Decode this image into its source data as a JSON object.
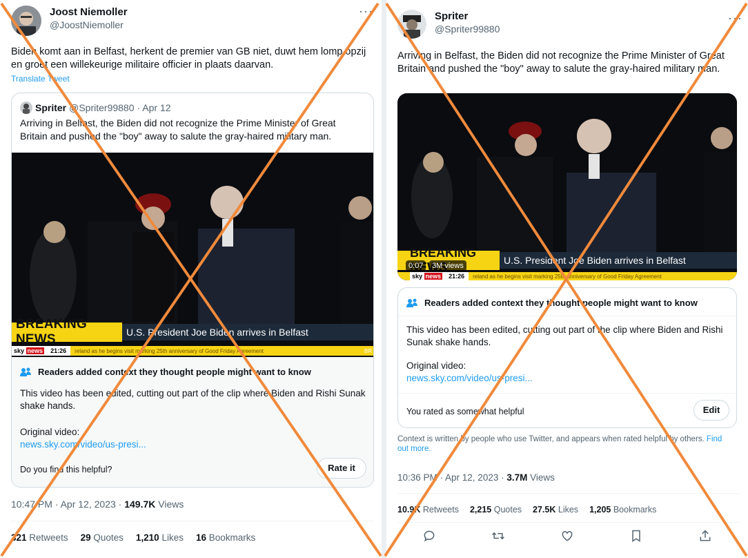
{
  "left_tweet": {
    "author_name": "Joost Niemoller",
    "author_handle": "@JoostNiemoller",
    "more_label": "···",
    "text": "Biden komt aan in Belfast, herkent de premier van GB niet, duwt hem lomp opzij en groet een willekeurige militaire officier in plaats daarvan.",
    "translate_label": "Translate Tweet",
    "quote": {
      "author_name": "Spriter",
      "author_handle": "@Spriter99880",
      "date": "· Apr 12",
      "text": "Arriving in Belfast, the Biden did not recognize the Prime Minister of Great Britain and pushed the \"boy\" away to salute the gray-haired military man.",
      "video": {
        "breaking": "BREAKING NEWS",
        "headline": "U.S. President Joe Biden arrives in Belfast",
        "sky": "sky",
        "sky_news": "news",
        "clock": "21:26",
        "ticker": "reland as he begins visit marking 25th anniversary of Good Friday Agreement",
        "ticker_end": "BR"
      },
      "notes": {
        "header": "Readers added context they thought people might want to know",
        "body": "This video has been edited, cutting out part of the clip where Biden and Rishi Sunak shake hands.",
        "original_label": "Original video:",
        "link": "news.sky.com/video/us-presi...",
        "question": "Do you find this helpful?",
        "rate_button": "Rate it"
      }
    },
    "timestamp": "10:47 PM · Apr 12, 2023 · ",
    "views_count": "149.7K",
    "views_label": "Views",
    "retweets_count": "321",
    "retweets_label": "Retweets",
    "quotes_count": "29",
    "quotes_label": "Quotes",
    "likes_count": "1,210",
    "likes_label": "Likes",
    "bookmarks_count": "16",
    "bookmarks_label": "Bookmarks"
  },
  "right_tweet": {
    "author_name": "Spriter",
    "author_handle": "@Spriter99880",
    "more_label": "···",
    "text": "Arriving in Belfast, the Biden did not recognize the Prime Minister of Great Britain and pushed the \"boy\" away to salute the gray-haired military man.",
    "video": {
      "breaking": "BREAKING NEWS",
      "headline": "U.S. President Joe Biden arrives in Belfast",
      "sky": "sky",
      "sky_news": "news",
      "clock": "21:26",
      "ticker": "reland as he begins visit marking 25th anniversary of Good Friday Agreement",
      "time": "0:07",
      "views": "3M views"
    },
    "notes": {
      "header": "Readers added context they thought people might want to know",
      "body": "This video has been edited, cutting out part of the clip where Biden and Rishi Sunak shake hands.",
      "original_label": "Original video:",
      "link": "news.sky.com/video/us-presi...",
      "rated": "You rated as somewhat helpful",
      "edit_button": "Edit"
    },
    "context_text": "Context is written by people who use Twitter, and appears when rated helpful by others. ",
    "context_link": "Find out more.",
    "timestamp": "10:36 PM · Apr 12, 2023 · ",
    "views_count": "3.7M",
    "views_label": "Views",
    "retweets_count": "10.9K",
    "retweets_label": "Retweets",
    "quotes_count": "2,215",
    "quotes_label": "Quotes",
    "likes_count": "27.5K",
    "likes_label": "Likes",
    "bookmarks_count": "1,205",
    "bookmarks_label": "Bookmarks",
    "action_icons": [
      "reply-icon",
      "retweet-icon",
      "like-icon",
      "bookmark-icon",
      "share-icon"
    ]
  },
  "colors": {
    "link": "#1d9bf0",
    "cross_mark": "#f08a3c",
    "breaking_yellow": "#f6d414",
    "sky_red": "#d40f1a"
  }
}
